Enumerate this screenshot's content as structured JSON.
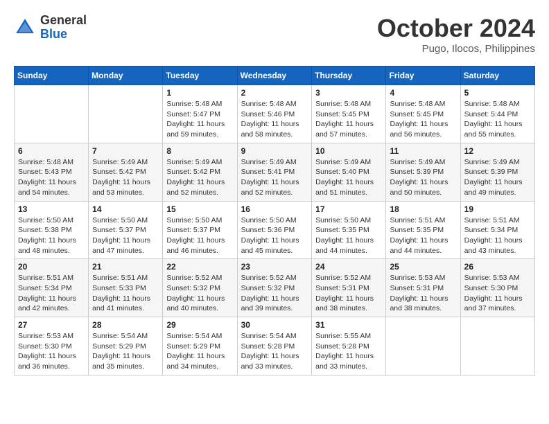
{
  "header": {
    "logo_general": "General",
    "logo_blue": "Blue",
    "month_year": "October 2024",
    "location": "Pugo, Ilocos, Philippines"
  },
  "weekdays": [
    "Sunday",
    "Monday",
    "Tuesday",
    "Wednesday",
    "Thursday",
    "Friday",
    "Saturday"
  ],
  "weeks": [
    [
      {
        "day": "",
        "info": ""
      },
      {
        "day": "",
        "info": ""
      },
      {
        "day": "1",
        "info": "Sunrise: 5:48 AM\nSunset: 5:47 PM\nDaylight: 11 hours\nand 59 minutes."
      },
      {
        "day": "2",
        "info": "Sunrise: 5:48 AM\nSunset: 5:46 PM\nDaylight: 11 hours\nand 58 minutes."
      },
      {
        "day": "3",
        "info": "Sunrise: 5:48 AM\nSunset: 5:45 PM\nDaylight: 11 hours\nand 57 minutes."
      },
      {
        "day": "4",
        "info": "Sunrise: 5:48 AM\nSunset: 5:45 PM\nDaylight: 11 hours\nand 56 minutes."
      },
      {
        "day": "5",
        "info": "Sunrise: 5:48 AM\nSunset: 5:44 PM\nDaylight: 11 hours\nand 55 minutes."
      }
    ],
    [
      {
        "day": "6",
        "info": "Sunrise: 5:48 AM\nSunset: 5:43 PM\nDaylight: 11 hours\nand 54 minutes."
      },
      {
        "day": "7",
        "info": "Sunrise: 5:49 AM\nSunset: 5:42 PM\nDaylight: 11 hours\nand 53 minutes."
      },
      {
        "day": "8",
        "info": "Sunrise: 5:49 AM\nSunset: 5:42 PM\nDaylight: 11 hours\nand 52 minutes."
      },
      {
        "day": "9",
        "info": "Sunrise: 5:49 AM\nSunset: 5:41 PM\nDaylight: 11 hours\nand 52 minutes."
      },
      {
        "day": "10",
        "info": "Sunrise: 5:49 AM\nSunset: 5:40 PM\nDaylight: 11 hours\nand 51 minutes."
      },
      {
        "day": "11",
        "info": "Sunrise: 5:49 AM\nSunset: 5:39 PM\nDaylight: 11 hours\nand 50 minutes."
      },
      {
        "day": "12",
        "info": "Sunrise: 5:49 AM\nSunset: 5:39 PM\nDaylight: 11 hours\nand 49 minutes."
      }
    ],
    [
      {
        "day": "13",
        "info": "Sunrise: 5:50 AM\nSunset: 5:38 PM\nDaylight: 11 hours\nand 48 minutes."
      },
      {
        "day": "14",
        "info": "Sunrise: 5:50 AM\nSunset: 5:37 PM\nDaylight: 11 hours\nand 47 minutes."
      },
      {
        "day": "15",
        "info": "Sunrise: 5:50 AM\nSunset: 5:37 PM\nDaylight: 11 hours\nand 46 minutes."
      },
      {
        "day": "16",
        "info": "Sunrise: 5:50 AM\nSunset: 5:36 PM\nDaylight: 11 hours\nand 45 minutes."
      },
      {
        "day": "17",
        "info": "Sunrise: 5:50 AM\nSunset: 5:35 PM\nDaylight: 11 hours\nand 44 minutes."
      },
      {
        "day": "18",
        "info": "Sunrise: 5:51 AM\nSunset: 5:35 PM\nDaylight: 11 hours\nand 44 minutes."
      },
      {
        "day": "19",
        "info": "Sunrise: 5:51 AM\nSunset: 5:34 PM\nDaylight: 11 hours\nand 43 minutes."
      }
    ],
    [
      {
        "day": "20",
        "info": "Sunrise: 5:51 AM\nSunset: 5:34 PM\nDaylight: 11 hours\nand 42 minutes."
      },
      {
        "day": "21",
        "info": "Sunrise: 5:51 AM\nSunset: 5:33 PM\nDaylight: 11 hours\nand 41 minutes."
      },
      {
        "day": "22",
        "info": "Sunrise: 5:52 AM\nSunset: 5:32 PM\nDaylight: 11 hours\nand 40 minutes."
      },
      {
        "day": "23",
        "info": "Sunrise: 5:52 AM\nSunset: 5:32 PM\nDaylight: 11 hours\nand 39 minutes."
      },
      {
        "day": "24",
        "info": "Sunrise: 5:52 AM\nSunset: 5:31 PM\nDaylight: 11 hours\nand 38 minutes."
      },
      {
        "day": "25",
        "info": "Sunrise: 5:53 AM\nSunset: 5:31 PM\nDaylight: 11 hours\nand 38 minutes."
      },
      {
        "day": "26",
        "info": "Sunrise: 5:53 AM\nSunset: 5:30 PM\nDaylight: 11 hours\nand 37 minutes."
      }
    ],
    [
      {
        "day": "27",
        "info": "Sunrise: 5:53 AM\nSunset: 5:30 PM\nDaylight: 11 hours\nand 36 minutes."
      },
      {
        "day": "28",
        "info": "Sunrise: 5:54 AM\nSunset: 5:29 PM\nDaylight: 11 hours\nand 35 minutes."
      },
      {
        "day": "29",
        "info": "Sunrise: 5:54 AM\nSunset: 5:29 PM\nDaylight: 11 hours\nand 34 minutes."
      },
      {
        "day": "30",
        "info": "Sunrise: 5:54 AM\nSunset: 5:28 PM\nDaylight: 11 hours\nand 33 minutes."
      },
      {
        "day": "31",
        "info": "Sunrise: 5:55 AM\nSunset: 5:28 PM\nDaylight: 11 hours\nand 33 minutes."
      },
      {
        "day": "",
        "info": ""
      },
      {
        "day": "",
        "info": ""
      }
    ]
  ]
}
